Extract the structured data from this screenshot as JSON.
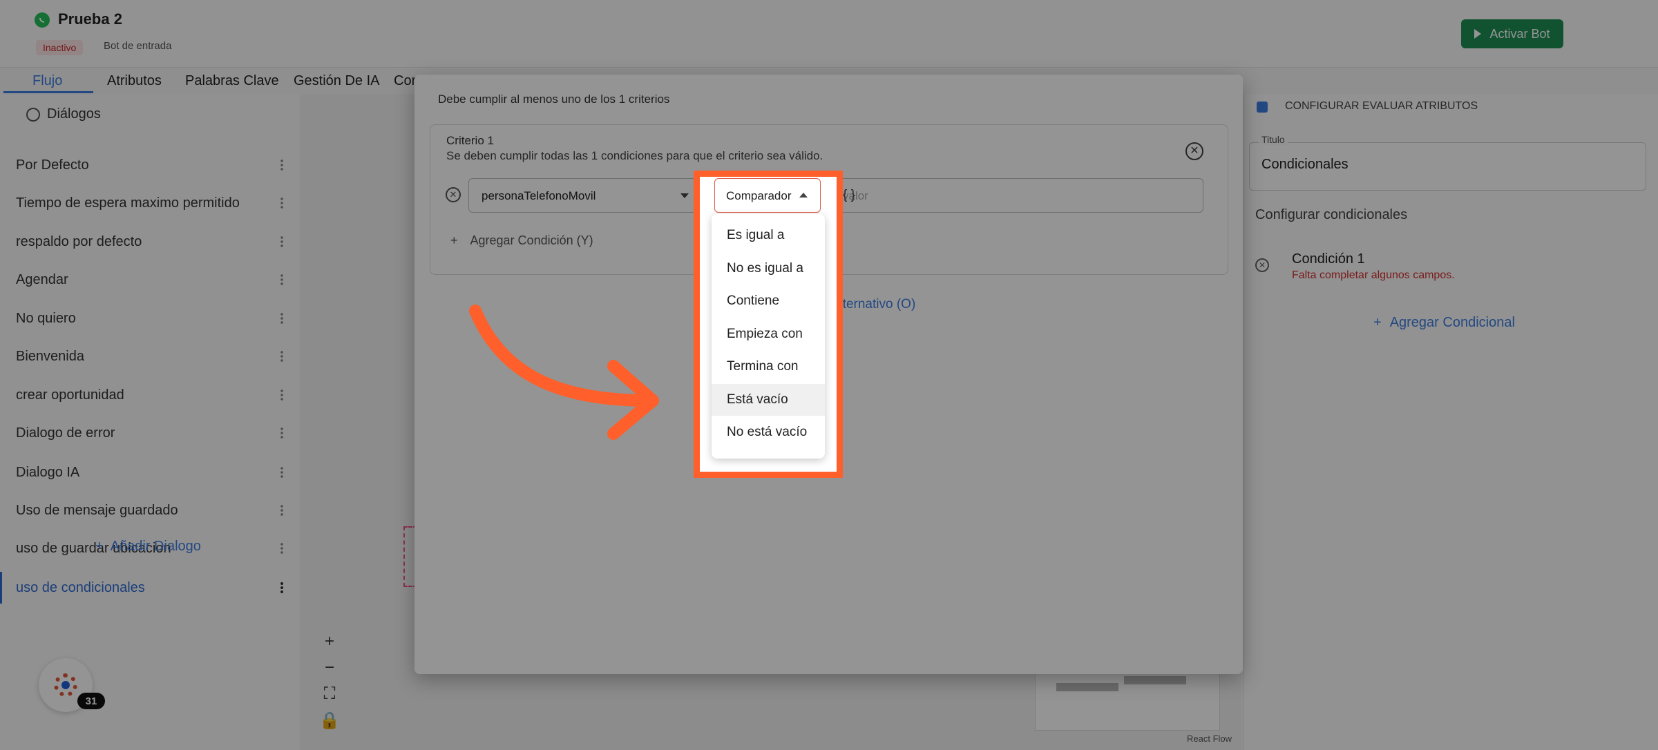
{
  "header": {
    "bot_name": "Prueba 2",
    "status_badge": "Inactivo",
    "bot_type": "Bot de entrada",
    "activate_button": "Activar Bot"
  },
  "tabs": [
    "Flujo",
    "Atributos",
    "Palabras Clave",
    "Gestión De IA",
    "Cor"
  ],
  "sidebar": {
    "header": "Diálogos",
    "items": [
      "Por Defecto",
      "Tiempo de espera maximo permitido",
      "respaldo por defecto",
      "Agendar",
      "No quiero",
      "Bienvenida",
      "crear oportunidad",
      "Dialogo de error",
      "Dialogo IA",
      "Uso de mensaje guardado",
      "uso de guardar ubicacion",
      "uso de condicionales"
    ],
    "add_dialog": "Añadir Dialogo",
    "notification_count": "31"
  },
  "canvas": {
    "zoom_in": "+",
    "zoom_out": "−",
    "attribution": "React Flow"
  },
  "right_panel": {
    "config_label": "CONFIGURAR EVALUAR ATRIBUTOS",
    "title_label": "Titulo",
    "title_value": "Condicionales",
    "configure_label": "Configurar condicionales",
    "condition_title": "Condición 1",
    "condition_error": "Falta completar algunos campos.",
    "add_conditional": "Agregar Condicional"
  },
  "modal": {
    "intro": "Debe cumplir al menos uno de los 1 criterios",
    "criterion_title": "Criterio 1",
    "criterion_desc": "Se deben cumplir todas las 1 condiciones para que el criterio sea válido.",
    "attribute_value": "personaTelefonoMovil",
    "comparator_label": "Comparador",
    "value_placeholder": "valor",
    "value_braces": "{ }",
    "add_condition": "Agregar Condición (Y)",
    "alt_link": "o Alternativo (O)"
  },
  "comparator_options": [
    "Es igual a",
    "No es igual a",
    "Contiene",
    "Empieza con",
    "Termina con",
    "Está vacío",
    "No está vacío"
  ],
  "colors": {
    "accent": "#3d7de0",
    "highlight": "#ff5f2a",
    "activate": "#1e8e54",
    "error": "#d32f2f"
  }
}
